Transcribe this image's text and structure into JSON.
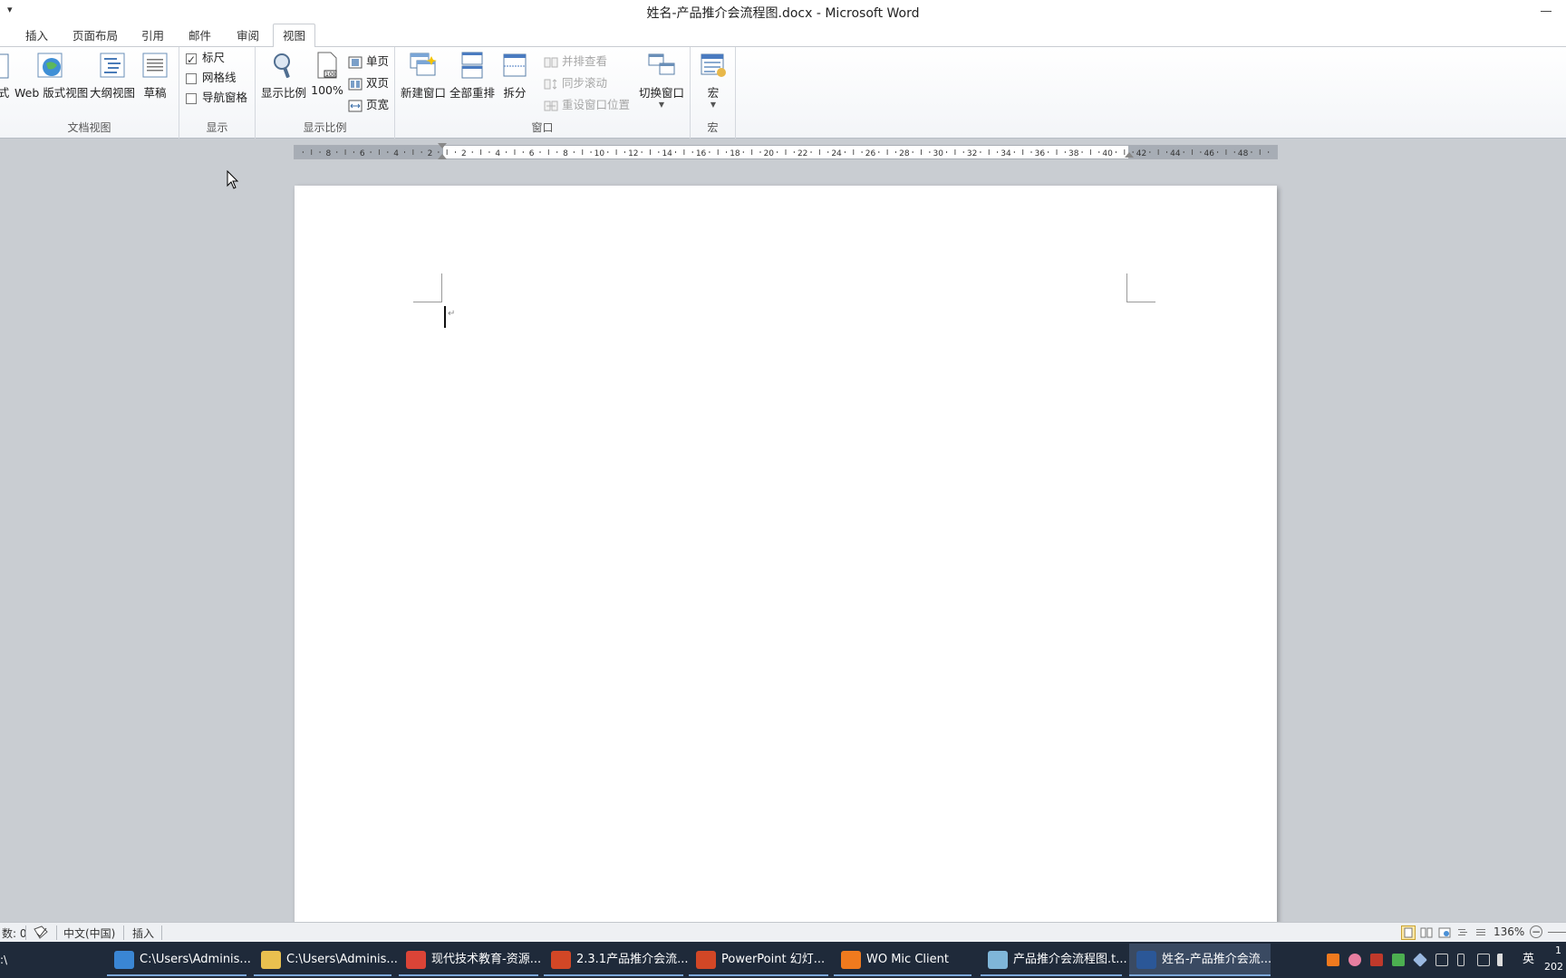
{
  "window": {
    "title": "姓名-产品推介会流程图.docx - Microsoft Word",
    "qat_symbol": "▾"
  },
  "tabs": [
    {
      "label": "插入"
    },
    {
      "label": "页面布局"
    },
    {
      "label": "引用"
    },
    {
      "label": "邮件"
    },
    {
      "label": "审阅"
    },
    {
      "label": "视图",
      "active": true
    }
  ],
  "ribbon": {
    "doc_views": {
      "label": "文档视图",
      "partial": "式",
      "web": "Web 版式视图",
      "outline": "大纲视图",
      "draft": "草稿"
    },
    "show": {
      "label": "显示",
      "ruler": {
        "label": "标尺",
        "checked": true
      },
      "gridlines": {
        "label": "网格线",
        "checked": false
      },
      "nav_pane": {
        "label": "导航窗格",
        "checked": false
      }
    },
    "zoom": {
      "label": "显示比例",
      "zoom": "显示比例",
      "hundred": "100%",
      "one_page": "单页",
      "two_pages": "双页",
      "page_width": "页宽"
    },
    "window": {
      "label": "窗口",
      "new_window": "新建窗口",
      "arrange_all": "全部重排",
      "split": "拆分",
      "side_by_side": "并排查看",
      "sync_scroll": "同步滚动",
      "reset_position": "重设窗口位置",
      "switch_windows": "切换窗口"
    },
    "macros": {
      "label": "宏",
      "macros": "宏"
    }
  },
  "ruler": {
    "labels": [
      "8",
      "6",
      "4",
      "2",
      "2",
      "4",
      "6",
      "8",
      "10",
      "12",
      "14",
      "16",
      "18",
      "20",
      "22",
      "24",
      "26",
      "28",
      "30",
      "32",
      "34",
      "36",
      "38",
      "40",
      "42",
      "44",
      "46",
      "48"
    ]
  },
  "statusbar": {
    "words": "数: 0",
    "language": "中文(中国)",
    "mode": "插入",
    "zoom": "136%",
    "zoom_minus": "−"
  },
  "taskbar": {
    "start_fragment": ":\\",
    "items": [
      {
        "label": "C:\\Users\\Adminis...",
        "color": "#3a86d4"
      },
      {
        "label": "C:\\Users\\Adminis...",
        "color": "#e9c04f"
      },
      {
        "label": "现代技术教育-资源...",
        "color": "#db4437"
      },
      {
        "label": "2.3.1产品推介会流...",
        "color": "#d24726"
      },
      {
        "label": "PowerPoint 幻灯...",
        "color": "#d24726"
      },
      {
        "label": "WO Mic Client",
        "color": "#f07a1e"
      },
      {
        "label": "产品推介会流程图.t...",
        "color": "#7fb6d9"
      },
      {
        "label": "姓名-产品推介会流...",
        "color": "#2b5797",
        "active": true
      }
    ],
    "ime": "英",
    "clock_top": "1",
    "clock_bottom": "202"
  },
  "colors": {
    "workspace": "#c9cdd2",
    "taskbar": "#1f2a3a",
    "accent": "#2b5797"
  }
}
